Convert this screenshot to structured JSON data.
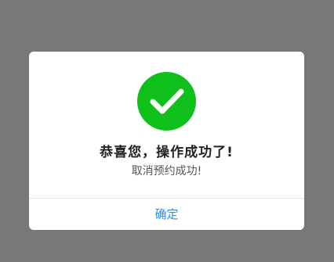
{
  "colors": {
    "overlay": "#78787a",
    "dialog_background": "#ffffff",
    "success_green": "#0fbf1a",
    "title_text": "#222222",
    "subtitle_text": "#555555",
    "button_text": "#2d8cf0",
    "divider": "#e6e6e6"
  },
  "dialog": {
    "icon": "check-circle-icon",
    "title": "恭喜您，操作成功了!",
    "message": "取消预约成功!",
    "confirm_label": "确定"
  }
}
